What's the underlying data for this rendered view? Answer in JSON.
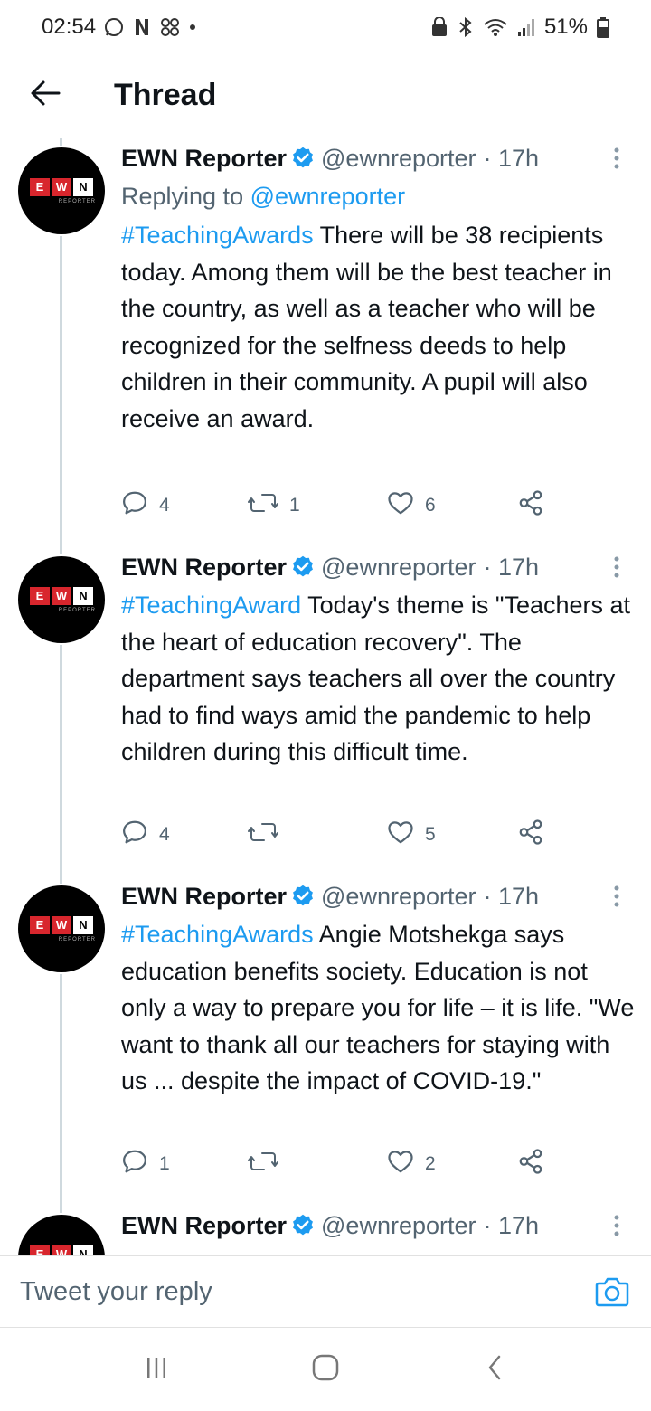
{
  "status_bar": {
    "time": "02:54",
    "battery": "51%"
  },
  "header": {
    "title": "Thread"
  },
  "colors": {
    "accent": "#1d9bf0",
    "secondary_text": "#536471",
    "logo_red": "#d8262d"
  },
  "avatar_logo": {
    "letters": [
      "E",
      "W",
      "N"
    ],
    "subtitle": "REPORTER"
  },
  "tweets": [
    {
      "name": "EWN Reporter",
      "handle": "@ewnreporter",
      "time": "· 17h",
      "replying_prefix": "Replying to",
      "replying_to": "@ewnreporter",
      "hashtag": "#TeachingAwards",
      "text": " There will be 38 recipients today. Among them will be the best teacher in the country, as well as a teacher who will be recognized for the selfness deeds to help children in their community. A pupil will also receive an award.",
      "replies": "4",
      "retweets": "1",
      "likes": "6"
    },
    {
      "name": "EWN Reporter",
      "handle": "@ewnreporter",
      "time": "· 17h",
      "hashtag": "#TeachingAward",
      "text": " Today's theme is \"Teachers at the heart of education recovery\". The department says teachers all over the country had to find ways amid the pandemic to help children during this difficult time.",
      "replies": "4",
      "retweets": "",
      "likes": "5"
    },
    {
      "name": "EWN Reporter",
      "handle": "@ewnreporter",
      "time": "· 17h",
      "hashtag": "#TeachingAwards",
      "text": " Angie Motshekga says education benefits society. Education is not only a way to prepare you for life – it is life. \"We want to thank all our teachers for staying with us ... despite the impact of COVID-19.\"",
      "replies": "1",
      "retweets": "",
      "likes": "2"
    },
    {
      "name": "EWN Reporter",
      "handle": "@ewnreporter",
      "time": "· 17h"
    }
  ],
  "reply_bar": {
    "placeholder": "Tweet your reply"
  },
  "icons": [
    "back-arrow-icon",
    "verified-badge-icon",
    "more-vertical-icon",
    "reply-icon",
    "retweet-icon",
    "like-icon",
    "share-icon",
    "camera-icon",
    "recent-apps-icon",
    "home-icon",
    "back-nav-icon"
  ]
}
